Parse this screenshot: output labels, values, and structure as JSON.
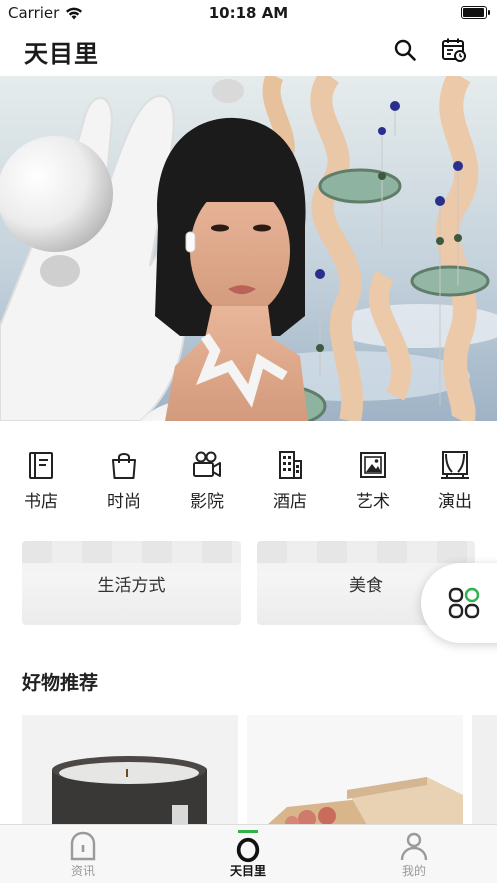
{
  "status_bar": {
    "carrier": "Carrier",
    "time": "10:18 AM",
    "battery_level": 0.95
  },
  "header": {
    "title": "天目里",
    "search_icon": "search-icon",
    "calendar_icon": "calendar-icon"
  },
  "categories": [
    {
      "label": "书店",
      "icon": "book-icon"
    },
    {
      "label": "时尚",
      "icon": "shopping-bag-icon"
    },
    {
      "label": "影院",
      "icon": "movie-camera-icon"
    },
    {
      "label": "酒店",
      "icon": "building-icon"
    },
    {
      "label": "艺术",
      "icon": "picture-frame-icon"
    },
    {
      "label": "演出",
      "icon": "stage-icon"
    }
  ],
  "cards": [
    {
      "label": "生活方式"
    },
    {
      "label": "美食"
    }
  ],
  "section": {
    "title": "好物推荐"
  },
  "tab_bar": {
    "items": [
      {
        "label": "资讯",
        "icon": "news-arch-icon"
      },
      {
        "label": "天目里",
        "icon": "ring-icon"
      },
      {
        "label": "我的",
        "icon": "person-icon"
      }
    ],
    "active_color": "#2db34a",
    "inactive_color": "#9a9a9a"
  },
  "colors": {
    "accent": "#2db34a"
  }
}
